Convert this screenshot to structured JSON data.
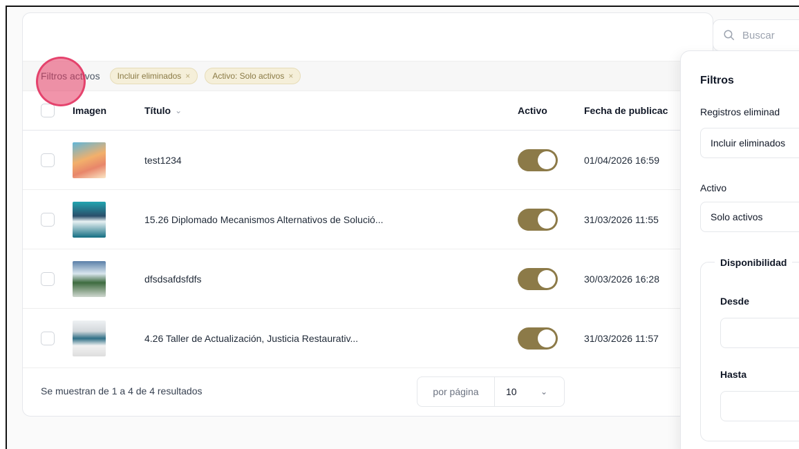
{
  "search": {
    "placeholder": "Buscar"
  },
  "filters": {
    "label": "Filtros activos",
    "chips": [
      {
        "label": "Incluir eliminados",
        "remove": "×"
      },
      {
        "label": "Activo: Solo activos",
        "remove": "×"
      }
    ]
  },
  "table": {
    "headers": {
      "image": "Imagen",
      "title": "Título",
      "active": "Activo",
      "date": "Fecha de publicac"
    },
    "rows": [
      {
        "title": "test1234",
        "active": true,
        "date": "01/04/2026 16:59"
      },
      {
        "title": "15.26 Diplomado Mecanismos Alternativos de Solució...",
        "active": true,
        "date": "31/03/2026 11:55"
      },
      {
        "title": "dfsdsafdsfdfs",
        "active": true,
        "date": "30/03/2026 16:28"
      },
      {
        "title": "4.26 Taller de Actualización, Justicia Restaurativ...",
        "active": true,
        "date": "31/03/2026 11:57"
      }
    ]
  },
  "footer": {
    "summary": "Se muestran de 1 a 4 de 4 resultados",
    "per_page_label": "por página",
    "per_page_value": "10"
  },
  "panel": {
    "title": "Filtros",
    "deleted_label": "Registros eliminad",
    "deleted_value": "Incluir eliminados",
    "active_label": "Activo",
    "active_value": "Solo activos",
    "availability": {
      "legend": "Disponibilidad",
      "from_label": "Desde",
      "to_label": "Hasta"
    }
  },
  "colors": {
    "toggle": "#8c7a48",
    "chip_bg": "#f5efd9"
  }
}
